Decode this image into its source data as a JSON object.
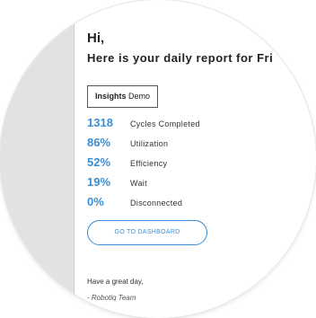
{
  "email": {
    "greeting": "Hi,",
    "headline": "Here is your daily report for Fri",
    "brand": {
      "name": "Insights",
      "suffix": "Demo"
    },
    "metrics": [
      {
        "value": "1318",
        "label": "Cycles Completed"
      },
      {
        "value": "86%",
        "label": "Utilization"
      },
      {
        "value": "52%",
        "label": "Efficiency"
      },
      {
        "value": "19%",
        "label": "Wait"
      },
      {
        "value": "0%",
        "label": "Disconnected"
      }
    ],
    "cta_label": "GO TO DASHBOARD",
    "signoff": "Have a great day,",
    "team": "- Robotiq Team"
  },
  "colors": {
    "accent": "#3a8fd6",
    "text": "#222222",
    "sidebar": "#e2e2e2"
  }
}
